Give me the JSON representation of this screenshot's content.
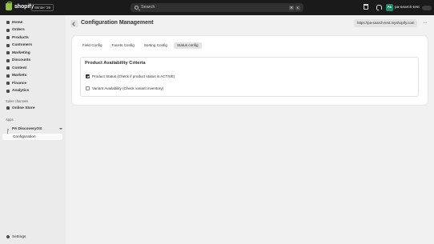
{
  "topbar": {
    "brand": "shopify",
    "edition": "Winter '26",
    "search_placeholder": "Search",
    "shortcut_keys": [
      "⌘",
      "K"
    ],
    "store_initials": "PA",
    "store_name": "pa-search-test"
  },
  "sidebar": {
    "nav": [
      {
        "label": "Home"
      },
      {
        "label": "Orders"
      },
      {
        "label": "Products"
      },
      {
        "label": "Customers"
      },
      {
        "label": "Marketing"
      },
      {
        "label": "Discounts"
      },
      {
        "label": "Content"
      },
      {
        "label": "Markets"
      },
      {
        "label": "Finance"
      },
      {
        "label": "Analytics"
      }
    ],
    "sales_channels_label": "Sales channels",
    "online_store_label": "Online Store",
    "apps_label": "Apps",
    "app_name": "PA DiscoveryOS",
    "app_sub_item": "Configuration",
    "settings_label": "Settings"
  },
  "page": {
    "title": "Configuration Management",
    "url": "https://pa-search-test.myshopify.com",
    "more_label": "···"
  },
  "tabs": [
    "Field Config",
    "Facets Config",
    "Sorting Config",
    "Status config"
  ],
  "active_tab": "Status config",
  "panel": {
    "title": "Product Availability Criteria",
    "options": [
      {
        "label": "Product Status (Check if product status is ACTIVE)",
        "checked": true
      },
      {
        "label": "Variant Availability (Check variant inventory)",
        "checked": false
      }
    ]
  }
}
